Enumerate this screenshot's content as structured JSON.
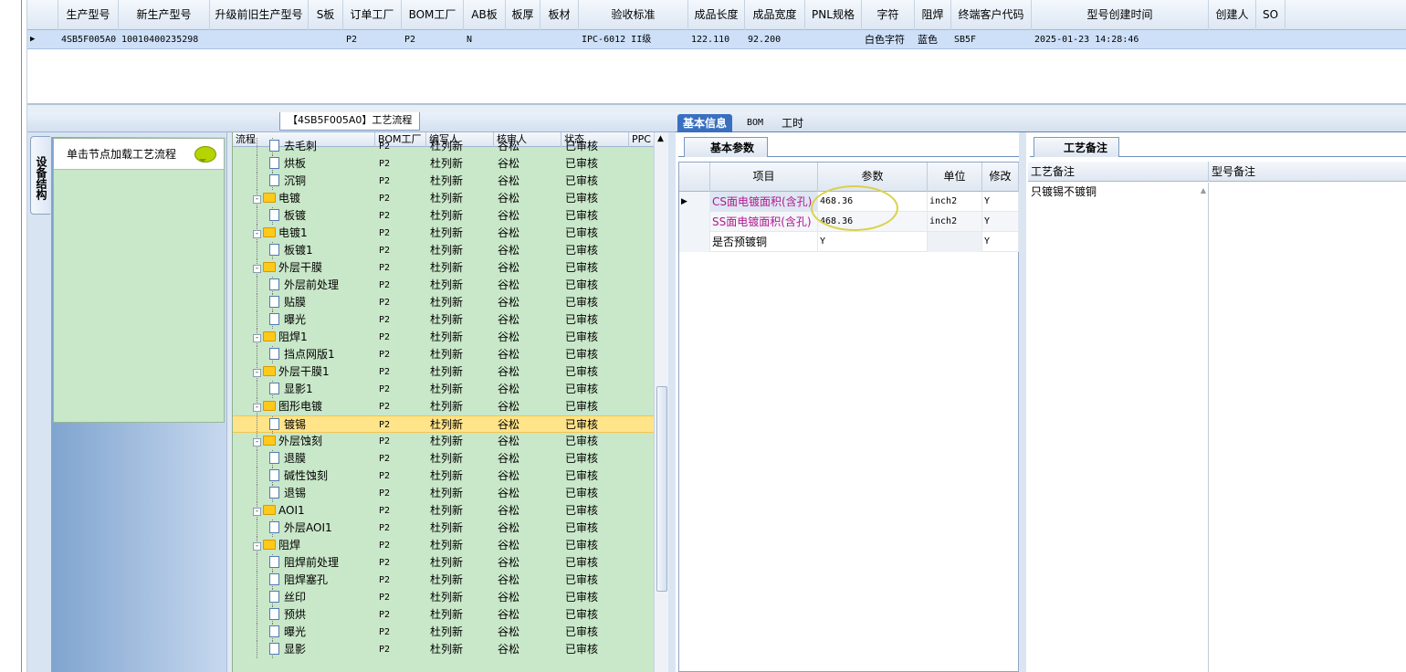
{
  "top_grid": {
    "columns": [
      "生产型号",
      "新生产型号",
      "升级前旧生产型号",
      "S板",
      "订单工厂",
      "BOM工厂",
      "AB板",
      "板厚",
      "板材",
      "验收标准",
      "成品长度",
      "成品宽度",
      "PNL规格",
      "字符",
      "阻焊",
      "终端客户代码",
      "型号创建时间",
      "创建人",
      "SO"
    ],
    "row": {
      "model": "4SB5F005A0",
      "new_model": "10010400235298",
      "old_model": "",
      "s_board": "",
      "order_factory": "P2",
      "bom_factory": "P2",
      "ab_board": "N",
      "thickness": "",
      "material": "",
      "standard": "IPC-6012 II级",
      "length": "122.110",
      "width": "92.200",
      "pnl": "",
      "char": "白色字符",
      "solder": "蓝色",
      "customer": "SB5F",
      "created": "2025-01-23 14:28:46",
      "creator": "",
      "so": ""
    }
  },
  "left_panel": {
    "flow_tab_title": "【4SB5F005A0】工艺流程",
    "vertical_tab": "设备结构",
    "load_hint": "单击节点加载工艺流程"
  },
  "tree": {
    "headers": [
      "流程",
      "BOM工厂",
      "编写人",
      "核审人",
      "状态",
      "PPC"
    ],
    "rows": [
      {
        "name": "去毛刺",
        "type": "doc",
        "bom": "P2",
        "writer": "杜列新",
        "reviewer": "谷松",
        "status": "已审核"
      },
      {
        "name": "烘板",
        "type": "doc",
        "bom": "P2",
        "writer": "杜列新",
        "reviewer": "谷松",
        "status": "已审核"
      },
      {
        "name": "沉铜",
        "type": "doc",
        "bom": "P2",
        "writer": "杜列新",
        "reviewer": "谷松",
        "status": "已审核"
      },
      {
        "name": "电镀",
        "type": "folder",
        "bom": "P2",
        "writer": "杜列新",
        "reviewer": "谷松",
        "status": "已审核"
      },
      {
        "name": "板镀",
        "type": "doc",
        "bom": "P2",
        "writer": "杜列新",
        "reviewer": "谷松",
        "status": "已审核"
      },
      {
        "name": "电镀1",
        "type": "folder",
        "bom": "P2",
        "writer": "杜列新",
        "reviewer": "谷松",
        "status": "已审核"
      },
      {
        "name": "板镀1",
        "type": "doc",
        "bom": "P2",
        "writer": "杜列新",
        "reviewer": "谷松",
        "status": "已审核"
      },
      {
        "name": "外层干膜",
        "type": "folder",
        "bom": "P2",
        "writer": "杜列新",
        "reviewer": "谷松",
        "status": "已审核"
      },
      {
        "name": "外层前处理",
        "type": "doc",
        "bom": "P2",
        "writer": "杜列新",
        "reviewer": "谷松",
        "status": "已审核"
      },
      {
        "name": "贴膜",
        "type": "doc",
        "bom": "P2",
        "writer": "杜列新",
        "reviewer": "谷松",
        "status": "已审核"
      },
      {
        "name": "曝光",
        "type": "doc",
        "bom": "P2",
        "writer": "杜列新",
        "reviewer": "谷松",
        "status": "已审核"
      },
      {
        "name": "阻焊1",
        "type": "folder",
        "bom": "P2",
        "writer": "杜列新",
        "reviewer": "谷松",
        "status": "已审核"
      },
      {
        "name": "挡点网版1",
        "type": "doc",
        "bom": "P2",
        "writer": "杜列新",
        "reviewer": "谷松",
        "status": "已审核"
      },
      {
        "name": "外层干膜1",
        "type": "folder",
        "bom": "P2",
        "writer": "杜列新",
        "reviewer": "谷松",
        "status": "已审核"
      },
      {
        "name": "显影1",
        "type": "doc",
        "bom": "P2",
        "writer": "杜列新",
        "reviewer": "谷松",
        "status": "已审核"
      },
      {
        "name": "图形电镀",
        "type": "folder",
        "bom": "P2",
        "writer": "杜列新",
        "reviewer": "谷松",
        "status": "已审核"
      },
      {
        "name": "镀锡",
        "type": "doc",
        "bom": "P2",
        "writer": "杜列新",
        "reviewer": "谷松",
        "status": "已审核",
        "selected": true
      },
      {
        "name": "外层蚀刻",
        "type": "folder",
        "bom": "P2",
        "writer": "杜列新",
        "reviewer": "谷松",
        "status": "已审核"
      },
      {
        "name": "退膜",
        "type": "doc",
        "bom": "P2",
        "writer": "杜列新",
        "reviewer": "谷松",
        "status": "已审核"
      },
      {
        "name": "碱性蚀刻",
        "type": "doc",
        "bom": "P2",
        "writer": "杜列新",
        "reviewer": "谷松",
        "status": "已审核"
      },
      {
        "name": "退锡",
        "type": "doc",
        "bom": "P2",
        "writer": "杜列新",
        "reviewer": "谷松",
        "status": "已审核"
      },
      {
        "name": "AOI1",
        "type": "folder",
        "bom": "P2",
        "writer": "杜列新",
        "reviewer": "谷松",
        "status": "已审核"
      },
      {
        "name": "外层AOI1",
        "type": "doc",
        "bom": "P2",
        "writer": "杜列新",
        "reviewer": "谷松",
        "status": "已审核"
      },
      {
        "name": "阻焊",
        "type": "folder",
        "bom": "P2",
        "writer": "杜列新",
        "reviewer": "谷松",
        "status": "已审核"
      },
      {
        "name": "阻焊前处理",
        "type": "doc",
        "bom": "P2",
        "writer": "杜列新",
        "reviewer": "谷松",
        "status": "已审核"
      },
      {
        "name": "阻焊塞孔",
        "type": "doc",
        "bom": "P2",
        "writer": "杜列新",
        "reviewer": "谷松",
        "status": "已审核"
      },
      {
        "name": "丝印",
        "type": "doc",
        "bom": "P2",
        "writer": "杜列新",
        "reviewer": "谷松",
        "status": "已审核"
      },
      {
        "name": "预烘",
        "type": "doc",
        "bom": "P2",
        "writer": "杜列新",
        "reviewer": "谷松",
        "status": "已审核"
      },
      {
        "name": "曝光",
        "type": "doc",
        "bom": "P2",
        "writer": "杜列新",
        "reviewer": "谷松",
        "status": "已审核"
      },
      {
        "name": "显影",
        "type": "doc",
        "bom": "P2",
        "writer": "杜列新",
        "reviewer": "谷松",
        "status": "已审核"
      }
    ]
  },
  "middle": {
    "tabs": [
      "基本信息",
      "BOM",
      "工时"
    ],
    "subtab": "基本参数",
    "headers": [
      "项目",
      "参数",
      "单位",
      "修改"
    ],
    "rows": [
      {
        "item": "CS面电镀面积(含孔)",
        "value": "468.36",
        "unit": "inch2",
        "mod": "Y"
      },
      {
        "item": "SS面电镀面积(含孔)",
        "value": "468.36",
        "unit": "inch2",
        "mod": "Y"
      },
      {
        "item": "是否预镀铜",
        "value": "Y",
        "unit": "",
        "mod": "Y"
      }
    ]
  },
  "right": {
    "tab": "工艺备注",
    "col1": "工艺备注",
    "col2": "型号备注",
    "note": "只镀锡不镀铜"
  }
}
